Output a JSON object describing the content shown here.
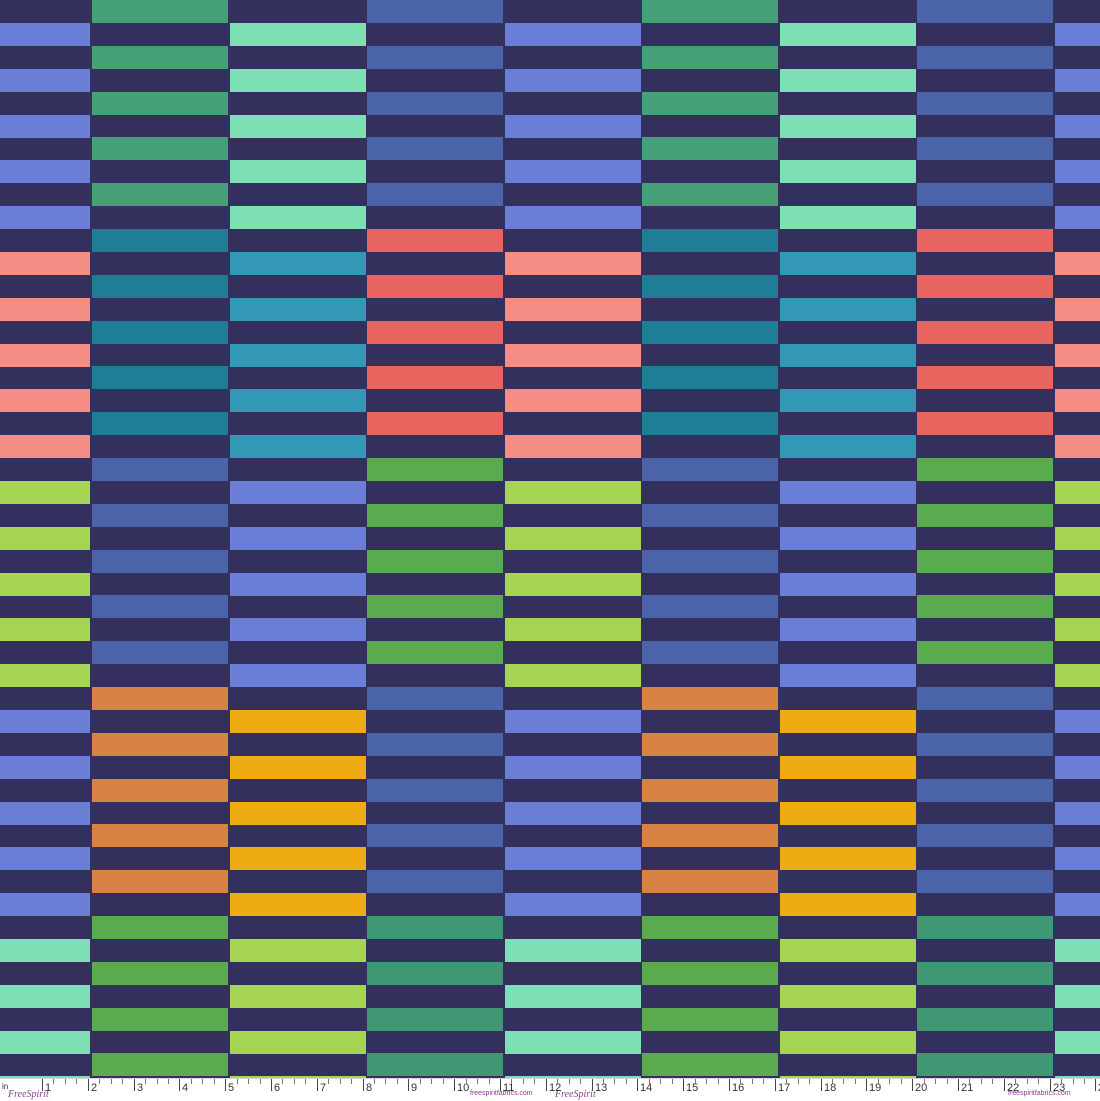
{
  "pattern": {
    "background": "#33305e",
    "bands": [
      {
        "from_row": 0,
        "to_row": 9,
        "columns": [
          "#46a077",
          "#7de0b5",
          "#4a63a9",
          "#6a7ed6",
          "#46a077",
          "#7de0b5",
          "#4a63a9",
          "#6a7ed6"
        ]
      },
      {
        "from_row": 10,
        "to_row": 19,
        "columns": [
          "#1f7e95",
          "#3397b6",
          "#e8655f",
          "#f58d85",
          "#1f7e95",
          "#3397b6",
          "#e8655f",
          "#f58d85"
        ]
      },
      {
        "from_row": 20,
        "to_row": 29,
        "columns": [
          "#4a63a9",
          "#6a7ed6",
          "#5aaa4f",
          "#a6d553",
          "#4a63a9",
          "#6a7ed6",
          "#5aaa4f",
          "#a6d553"
        ]
      },
      {
        "from_row": 30,
        "to_row": 39,
        "columns": [
          "#d88244",
          "#eeab12",
          "#4a63a9",
          "#6a7ed6",
          "#d88244",
          "#eeab12",
          "#4a63a9",
          "#6a7ed6"
        ]
      },
      {
        "from_row": 40,
        "to_row": 47,
        "columns": [
          "#5aaa4f",
          "#a6d553",
          "#3f9873",
          "#7de0b5",
          "#5aaa4f",
          "#a6d553",
          "#3f9873",
          "#7de0b5"
        ]
      }
    ]
  },
  "ruler": {
    "unit_label": "in",
    "labels": [
      "1",
      "2",
      "3",
      "4",
      "5",
      "6",
      "7",
      "8",
      "9",
      "10",
      "11",
      "12",
      "13",
      "14",
      "15",
      "16",
      "17",
      "18",
      "19",
      "20",
      "21",
      "22",
      "23",
      "24"
    ],
    "brand": "FreeSpirit",
    "site": "freespiritfabrics.com"
  }
}
